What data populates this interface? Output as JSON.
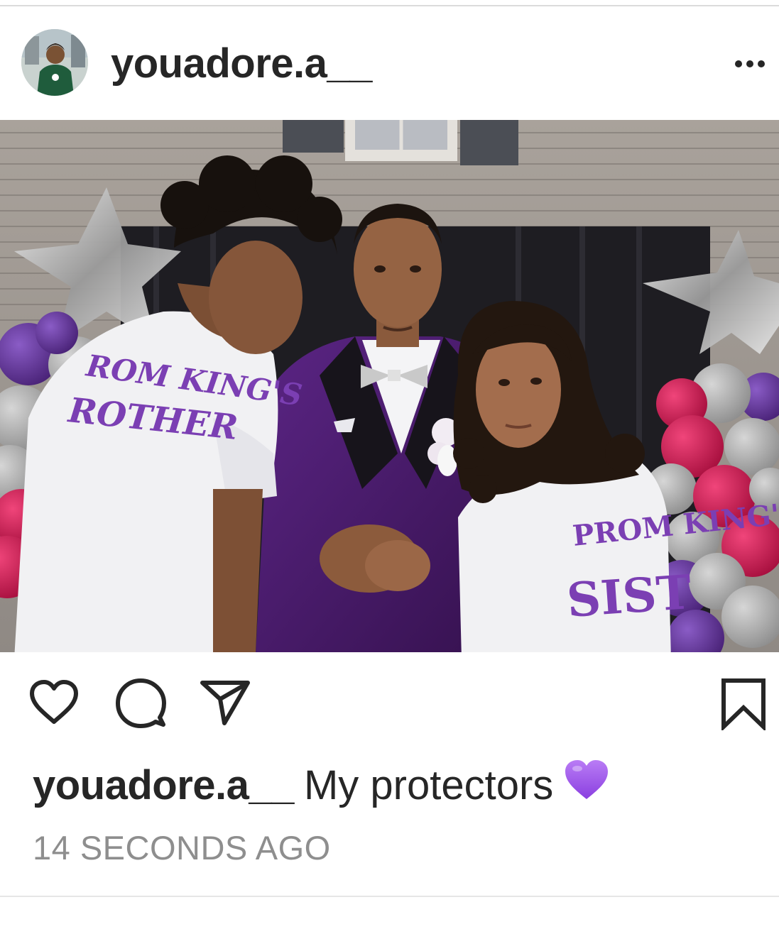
{
  "post": {
    "username": "youadore.a__",
    "avatar_icon": "profile-photo",
    "more_icon": "more-horizontal-icon",
    "photo_description_icon": "post-photo",
    "caption": {
      "username": "youadore.a__",
      "text": "My protectors",
      "emoji": "purple-heart"
    },
    "timestamp": "14 SECONDS AGO"
  },
  "actions": {
    "like_icon": "heart-outline-icon",
    "comment_icon": "comment-bubble-icon",
    "share_icon": "paper-plane-icon",
    "save_icon": "bookmark-icon"
  },
  "photo_shirt_texts": {
    "left_line1": "ROM KING'S",
    "left_line2": "ROTHER",
    "right_line1": "PROM KING'",
    "right_line2": "SIST"
  },
  "colors": {
    "text": "#262626",
    "muted": "#8e8e8e",
    "purple_heart": "#9b5de5",
    "suit_purple": "#4b1a6b"
  }
}
